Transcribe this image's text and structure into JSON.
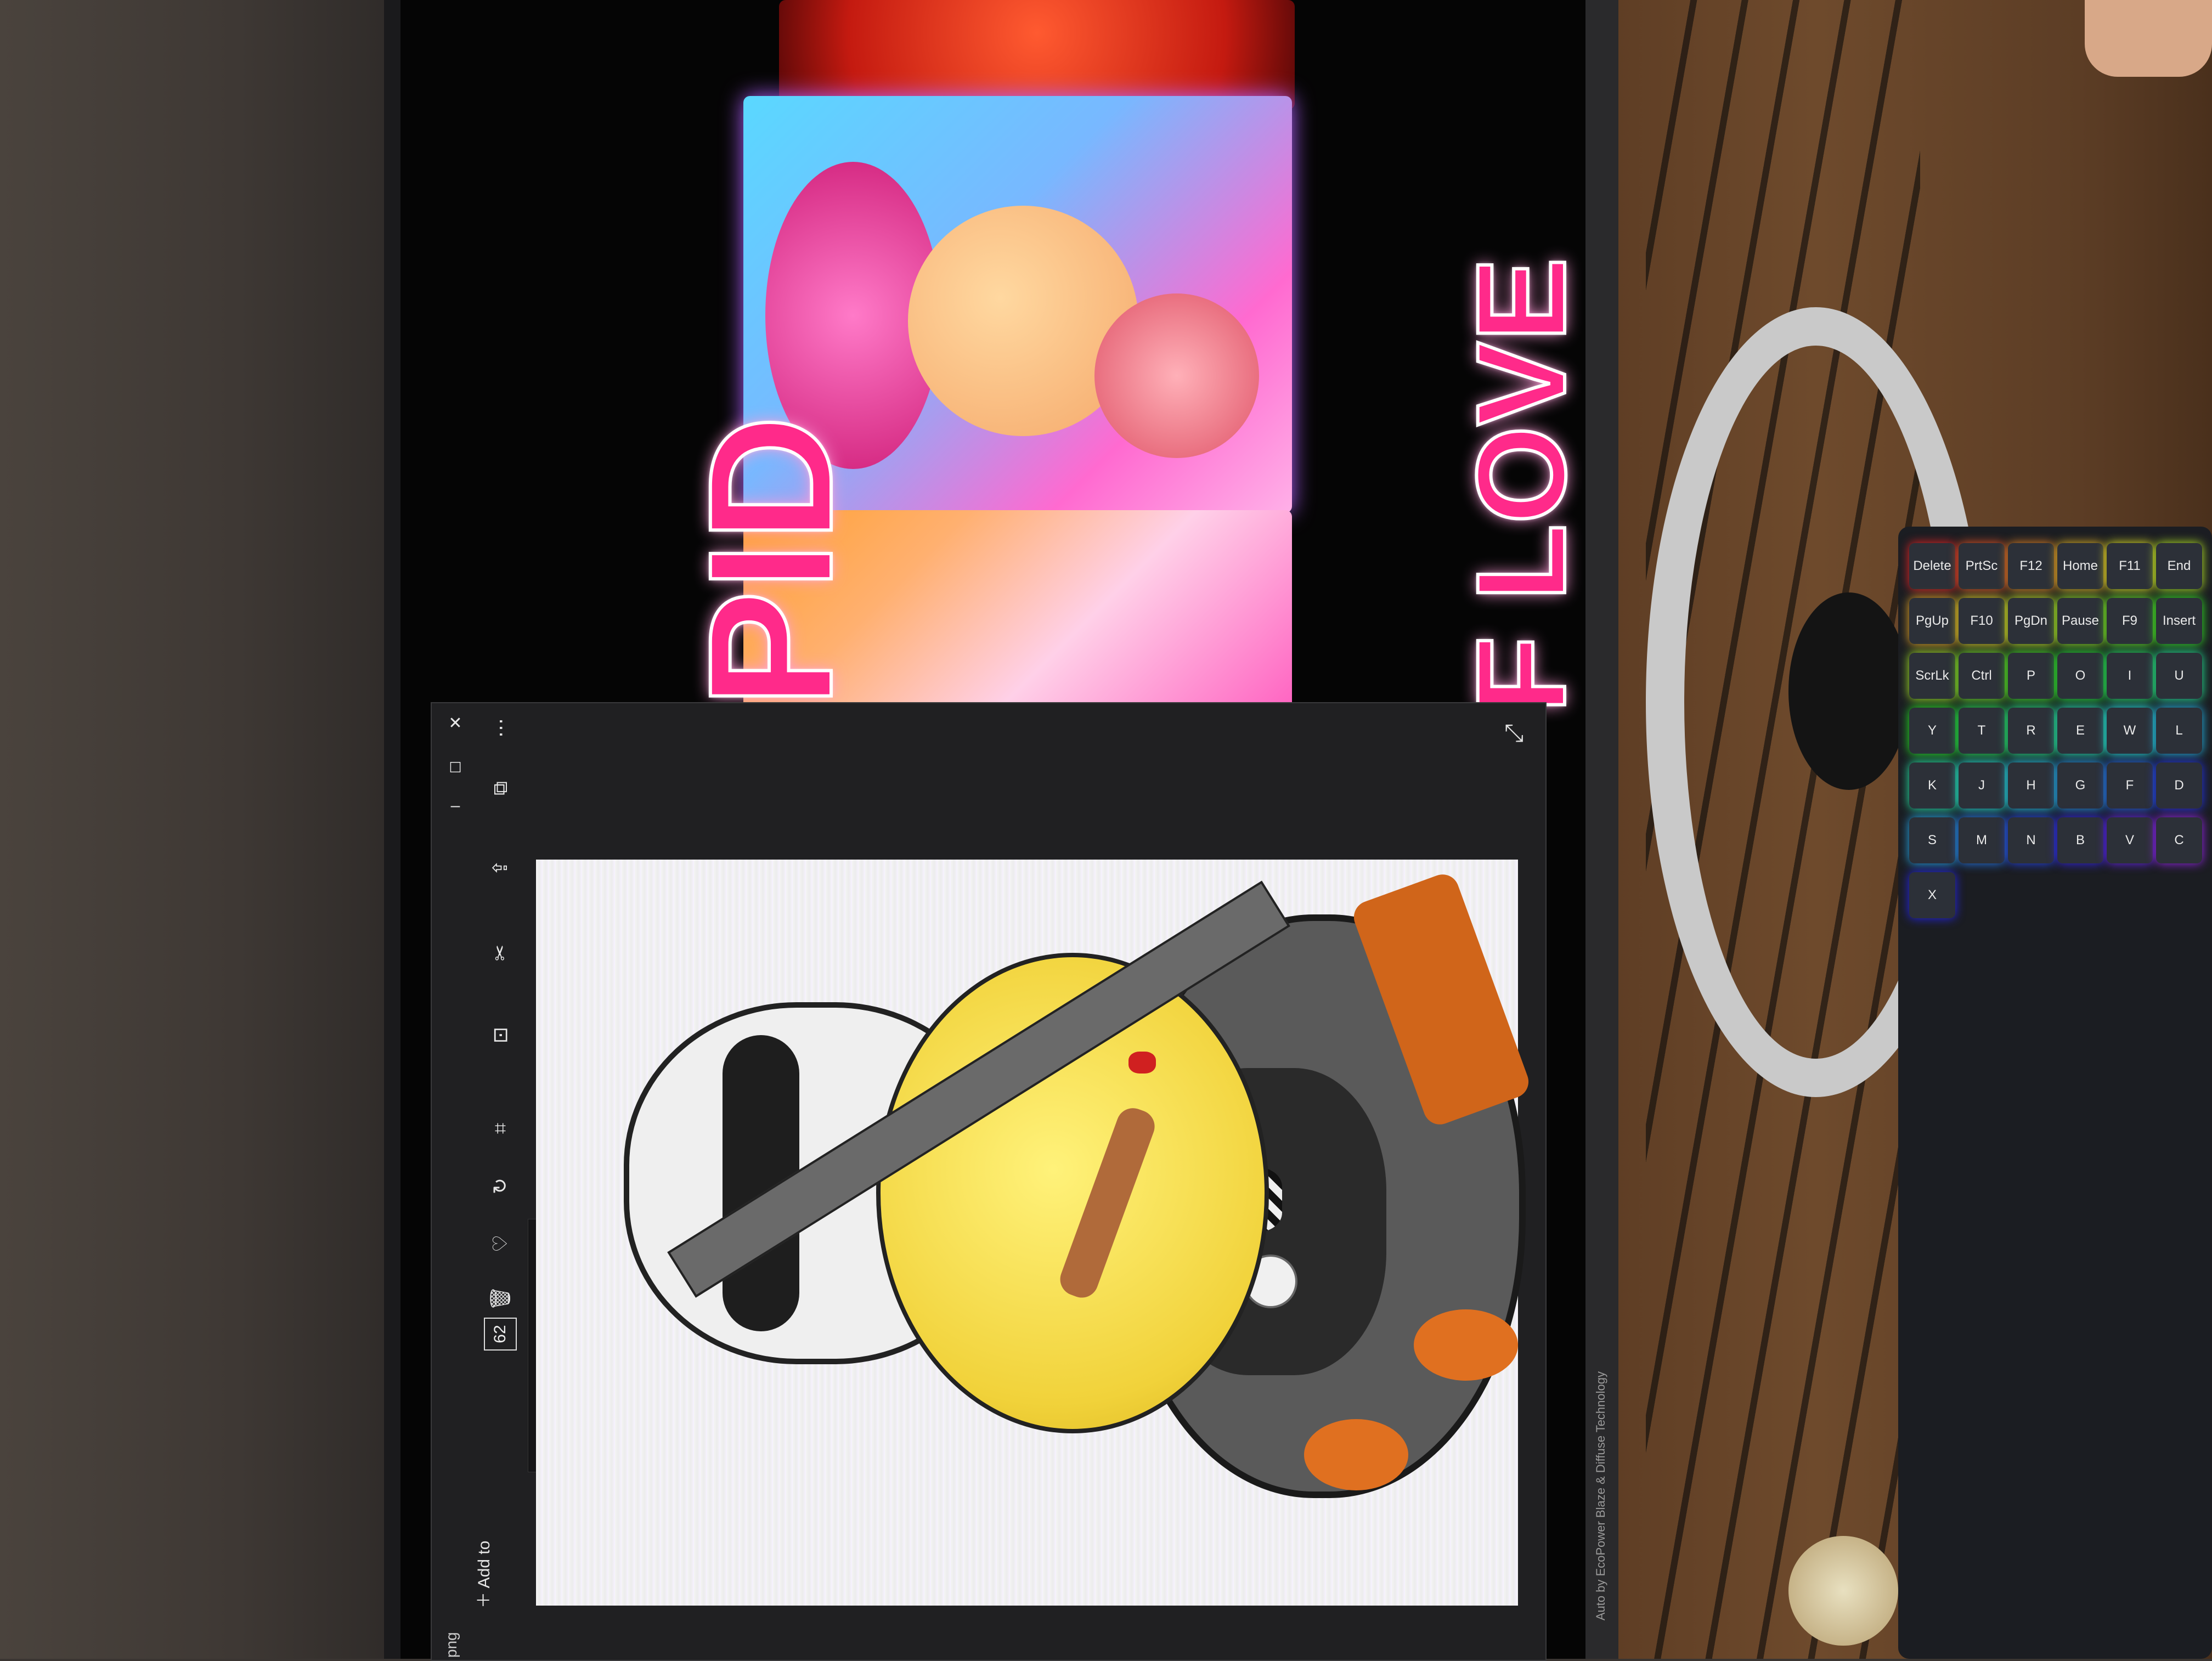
{
  "photo": {
    "viewer": {
      "toolbar": {
        "add_to_label": "Add to",
        "file_extension": "png",
        "zoom_value": "62",
        "zoom_fraction": 0.62
      },
      "icons": [
        "close-icon",
        "maximize-icon",
        "minimize-icon",
        "more-options-icon",
        "share-icon",
        "export-icon",
        "edit-icon",
        "capture-icon",
        "crop-icon",
        "rotate-icon",
        "favorite-icon",
        "delete-icon",
        "resize-icon"
      ]
    },
    "background_page": {
      "title_line_1": "PID",
      "title_line_2": "F LOVE"
    },
    "keyboard": {
      "keys": [
        "Delete",
        "PrtSc",
        "F12",
        "Home",
        "F11",
        "End",
        "PgUp",
        "F10",
        "PgDn",
        "Pause",
        "F9",
        "Insert",
        "ScrLk",
        "Ctrl",
        "P",
        "O",
        "I",
        "U",
        "Y",
        "T",
        "R",
        "E",
        "W",
        "L",
        "K",
        "J",
        "H",
        "G",
        "F",
        "D",
        "S",
        "M",
        "N",
        "B",
        "V",
        "C",
        "X"
      ]
    },
    "monitor_caption": "Auto by EcoPower  Blaze & Diffuse Technology",
    "colors": {
      "title_pink": "#ff2a8a",
      "viewer_dark": "#202022",
      "zoom_accent": "#4ab8e8"
    }
  }
}
